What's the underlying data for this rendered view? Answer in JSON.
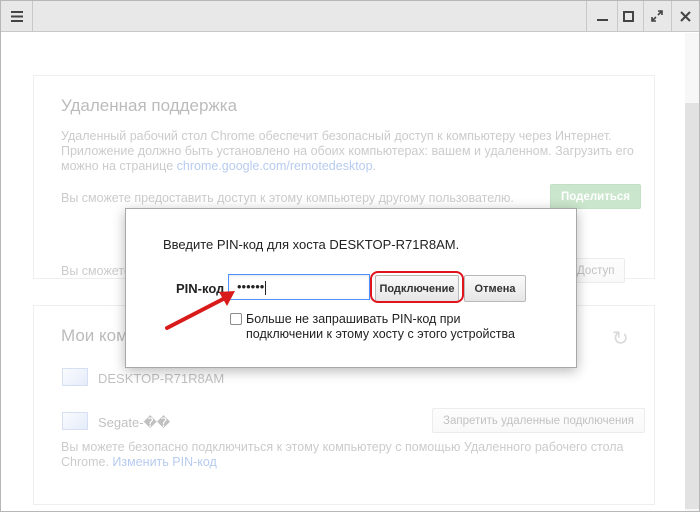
{
  "titlebar": {
    "menu_icon": "hamburger-menu-icon",
    "minimize_icon": "minimize-icon",
    "maximize_icon": "maximize-icon",
    "fullscreen_icon": "fullscreen-icon",
    "close_icon": "close-icon"
  },
  "remote_support": {
    "title": "Удаленная поддержка",
    "desc_line1": "Удаленный рабочий стол Chrome обеспечит безопасный доступ к компьютеру через Интернет.",
    "desc_line2": "Приложение должно быть установлено на обоих компьютерах: вашем и удаленном. Загрузить его",
    "desc_line3_prefix": "можно на странице ",
    "desc_link": "chrome.google.com/remotedesktop",
    "desc_line3_suffix": ".",
    "share_text": "Вы сможете предоставить доступ к этому компьютеру другому пользователю.",
    "share_button": "Поделиться",
    "access_text": "Вы сможете",
    "access_button": "Доступ"
  },
  "my_computers": {
    "title": "Мои компь",
    "refresh_icon": "refresh-icon",
    "hosts": [
      {
        "name": "DESKTOP-R71R8AM",
        "icon": "monitor-icon"
      },
      {
        "name": "Segate-��",
        "icon": "monitor-icon"
      }
    ],
    "disable_button": "Запретить удаленные подключения",
    "footer_line1": "Вы можете безопасно подключиться к этому компьютеру с помощью Удаленного рабочего стола",
    "footer_line2_prefix": "Chrome. ",
    "footer_link": "Изменить PIN-код"
  },
  "dialog": {
    "prompt": "Введите PIN-код для хоста DESKTOP-R71R8AM.",
    "pin_label": "PIN-код",
    "pin_value": "••••••",
    "connect_button": "Подключение",
    "cancel_button": "Отмена",
    "checkbox_label_line1": "Больше не запрашивать PIN-код при",
    "checkbox_label_line2": "подключении к этому хосту с этого устройства",
    "checkbox_checked": false
  },
  "colors": {
    "highlight_ring": "#e0141d",
    "arrow": "#d91a1a",
    "share_button": "#53b05a",
    "link": "#1155cc"
  }
}
